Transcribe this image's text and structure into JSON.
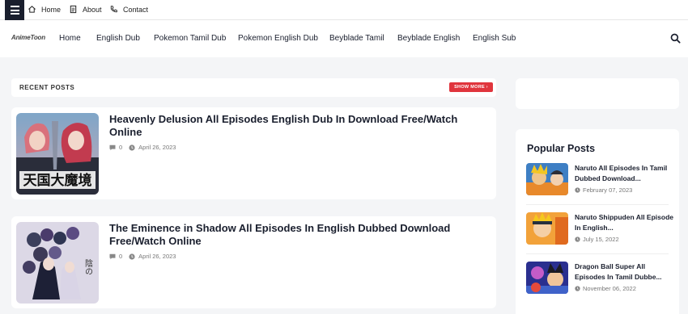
{
  "topbar": {
    "links": [
      {
        "label": "Home",
        "icon": "home-icon"
      },
      {
        "label": "About",
        "icon": "document-icon"
      },
      {
        "label": "Contact",
        "icon": "phone-icon"
      }
    ]
  },
  "nav": {
    "logo": "AnimeToon",
    "items": [
      "Home",
      "English Dub",
      "Pokemon Tamil Dub",
      "Pokemon English Dub",
      "Beyblade Tamil",
      "Beyblade English",
      "English Sub"
    ]
  },
  "recent": {
    "title": "RECENT POSTS",
    "show_more": "SHOW MORE",
    "posts": [
      {
        "title": "Heavenly Delusion All Episodes English Dub In Download Free/Watch Online",
        "comments": "0",
        "date": "April 26, 2023",
        "thumb_text": "天国大魔境"
      },
      {
        "title": "The Eminence in Shadow All Episodes In English Dubbed Download Free/Watch Online",
        "comments": "0",
        "date": "April 26, 2023",
        "thumb_text": "陰の"
      }
    ]
  },
  "popular": {
    "title": "Popular Posts",
    "items": [
      {
        "title": "Naruto All Episodes In Tamil Dubbed Download...",
        "date": "February 07, 2023"
      },
      {
        "title": "Naruto Shippuden All Episode In English...",
        "date": "July 15, 2022"
      },
      {
        "title": "Dragon Ball Super All Episodes In Tamil Dubbe...",
        "date": "November 06, 2022"
      }
    ]
  },
  "colors": {
    "accent": "#e0353d",
    "dark": "#1a1f2e",
    "background": "#f4f5f7"
  }
}
